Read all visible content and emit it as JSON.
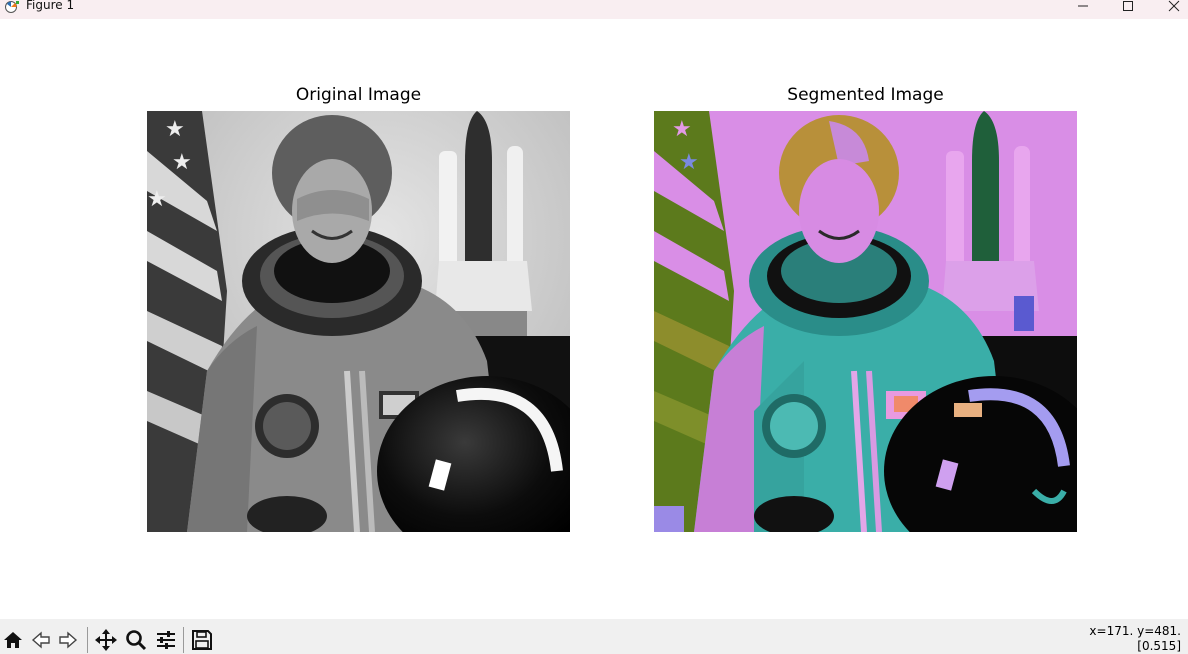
{
  "window": {
    "title": "Figure 1",
    "controls": [
      "minimize",
      "maximize",
      "close"
    ]
  },
  "axes": [
    {
      "title": "Original Image",
      "image": "grayscale astronaut portrait"
    },
    {
      "title": "Segmented Image",
      "image": "color-segmented astronaut portrait"
    }
  ],
  "toolbar": {
    "tools": [
      "home-icon",
      "back-icon",
      "forward-icon",
      "pan-icon",
      "zoom-icon",
      "configure-subplots-icon",
      "save-icon"
    ],
    "status_line1": "x=171. y=481.",
    "status_line2": "[0.515]"
  },
  "colors": {
    "titlebar_bg": "#f9eef1",
    "toolbar_bg": "#f0f0f0",
    "segment_magenta": "#d98ee6",
    "segment_teal": "#3aaea8",
    "segment_olive": "#8a8a2a",
    "segment_gold": "#b8903a"
  }
}
